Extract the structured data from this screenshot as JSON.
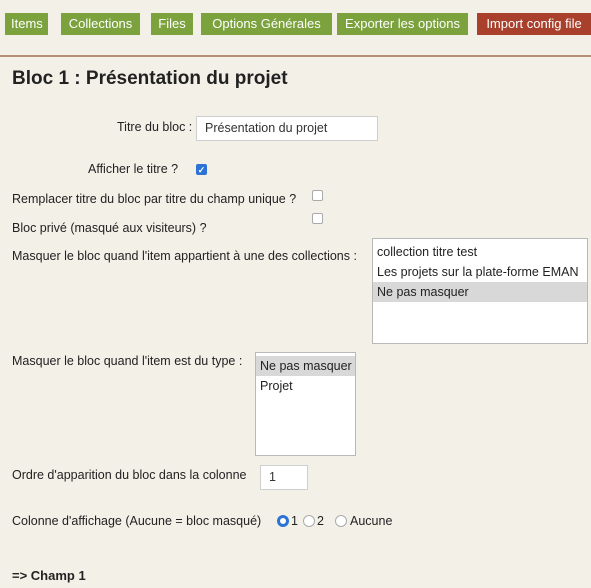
{
  "tabs": [
    {
      "label": "Items"
    },
    {
      "label": "Collections"
    },
    {
      "label": "Files"
    },
    {
      "label": "Options Générales"
    },
    {
      "label": "Exporter les options"
    },
    {
      "label": "Import config file"
    }
  ],
  "bloc": {
    "heading": "Bloc 1 : Présentation du projet",
    "titre_label": "Titre du bloc :",
    "titre_value": "Présentation du projet",
    "afficher_label": "Afficher le titre ?",
    "afficher_checked": true,
    "remplacer_label": "Remplacer titre du bloc par titre du champ unique ?",
    "remplacer_checked": false,
    "prive_label": "Bloc privé (masqué aux visiteurs) ?",
    "prive_checked": false,
    "masquer_collections_label": "Masquer le bloc quand l'item appartient à une des collections :",
    "collections_options": [
      "collection titre test",
      "Les projets sur la plate-forme EMAN",
      "Ne pas masquer"
    ],
    "collections_selected": "Ne pas masquer",
    "masquer_type_label": "Masquer le bloc quand l'item est du type :",
    "type_options": [
      "Ne pas masquer",
      "Projet"
    ],
    "type_selected": "Ne pas masquer",
    "ordre_label": "Ordre d'apparition du bloc dans la colonne",
    "ordre_value": "1",
    "colonne_label": "Colonne d'affichage (Aucune = bloc masqué)",
    "colonne_options": [
      "1",
      "2",
      "Aucune"
    ],
    "colonne_selected": "1"
  },
  "next_section": "=> Champ 1",
  "colors": {
    "tab_green": "#7ba23c",
    "tab_red": "#a8402c",
    "accent_blue": "#2d73d6",
    "background": "#f3f0e8"
  }
}
